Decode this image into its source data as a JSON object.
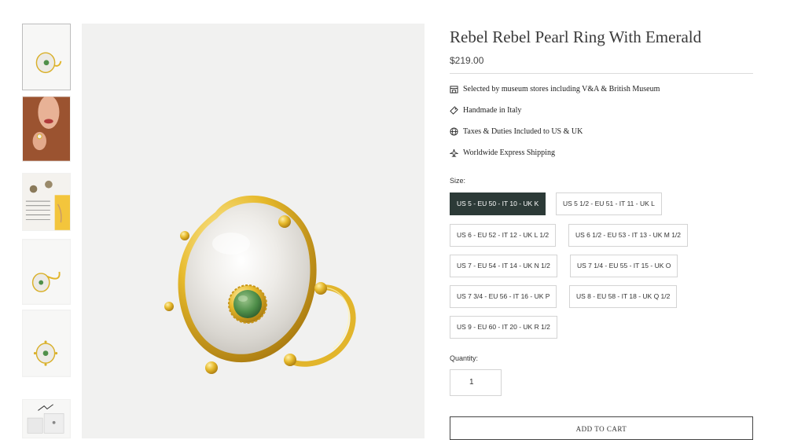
{
  "product": {
    "title": "Rebel Rebel Pearl Ring With Emerald",
    "price": "$219.00"
  },
  "features": [
    {
      "icon": "store-icon",
      "text": "Selected by museum stores including V&A & British Museum"
    },
    {
      "icon": "tag-icon",
      "text": "Handmade in Italy"
    },
    {
      "icon": "globe-icon",
      "text": "Taxes & Duties Included to US & UK"
    },
    {
      "icon": "plane-icon",
      "text": "Worldwide Express Shipping"
    }
  ],
  "size": {
    "label": "Size:",
    "selected": "US 5 - EU 50 - IT 10 - UK K",
    "options": [
      "US 5 - EU 50 - IT 10 - UK K",
      "US 5 1/2 - EU 51 - IT 11 - UK L",
      "US 6 - EU 52 - IT 12 - UK L 1/2",
      "US 6 1/2 - EU 53 - IT 13 - UK M 1/2",
      "US 7 - EU 54 - IT 14 - UK N 1/2",
      "US 7 1/4 - EU 55 - IT 15 - UK O",
      "US 7 3/4 - EU 56 - IT 16 - UK P",
      "US 8 - EU 58 - IT 18 - UK Q 1/2",
      "US 9 - EU 60 - IT 20 - UK R 1/2"
    ]
  },
  "quantity": {
    "label": "Quantity:",
    "value": "1"
  },
  "cart": {
    "button_label": "ADD TO CART"
  },
  "thumbnails": [
    "ring-front-thumbnail",
    "model-wearing-thumbnail",
    "styled-flatlay-thumbnail",
    "ring-side-thumbnail",
    "ring-top-thumbnail",
    "packaging-thumbnail"
  ],
  "colors": {
    "selected_size_bg": "#2c3a37",
    "gold": "#e2b52b",
    "emerald": "#4f8f4a"
  }
}
